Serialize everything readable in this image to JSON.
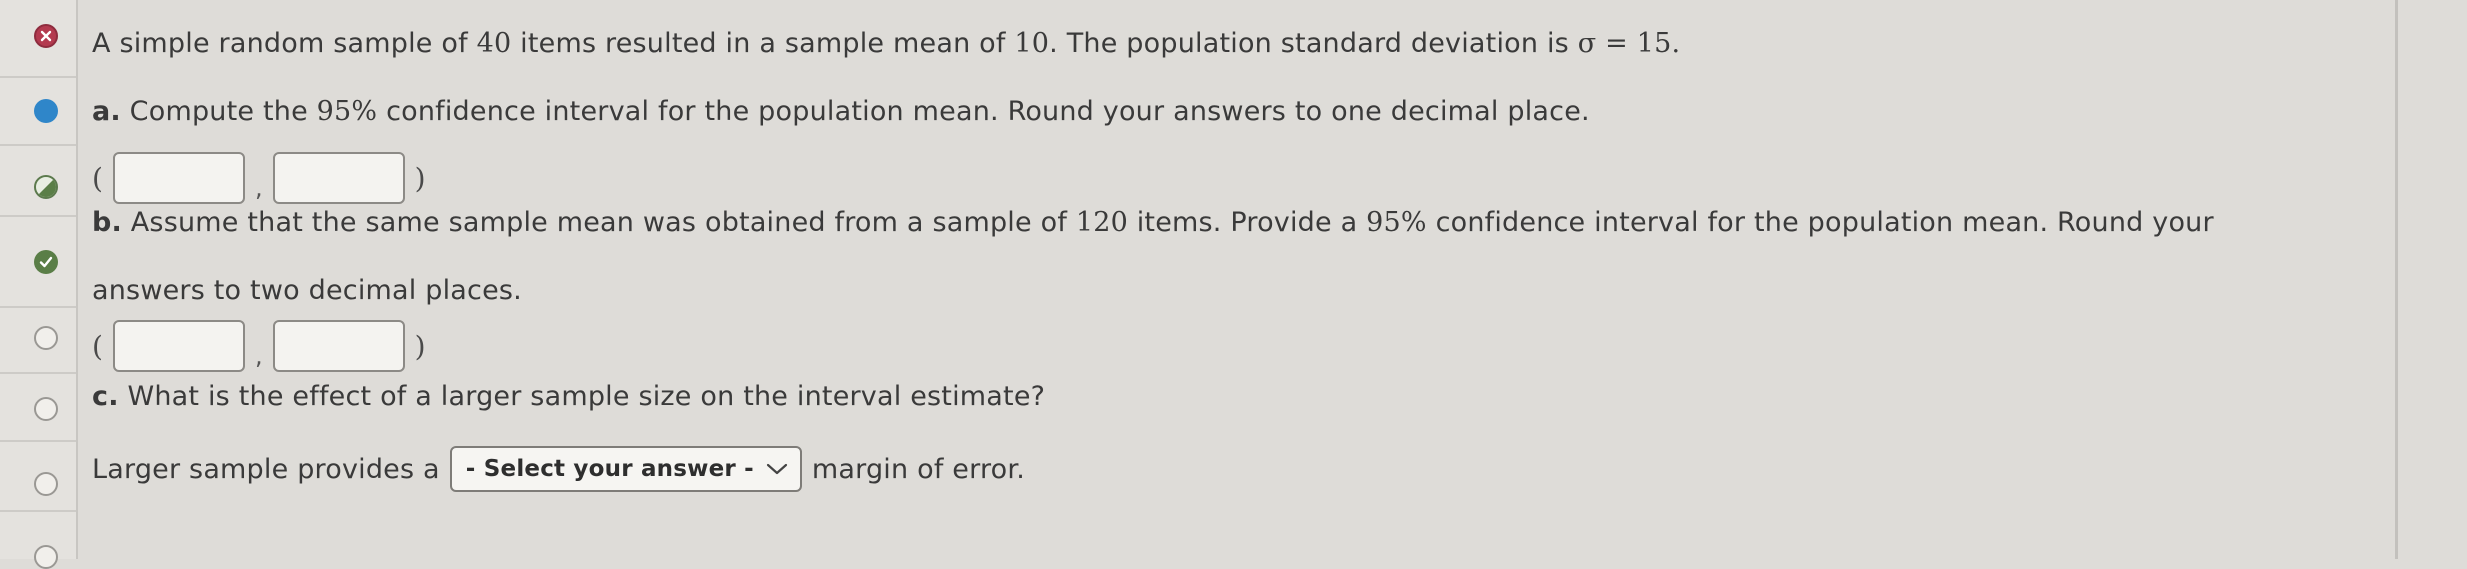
{
  "question": {
    "intro": {
      "text_1": "A simple random sample of ",
      "n": "40",
      "text_2": " items resulted in a sample mean of ",
      "mean": "10",
      "text_3": ". The population standard deviation is ",
      "sigma_expr": "σ = 15",
      "text_4": "."
    },
    "part_a": {
      "letter": "a.",
      "text_1": " Compute the ",
      "pct": "95%",
      "text_2": " confidence interval for the population mean. Round your answers to one decimal place.",
      "open_paren": "(",
      "comma": ",",
      "close_paren": ")"
    },
    "part_b": {
      "letter": "b.",
      "text_1": " Assume that the same sample mean was obtained from a sample of ",
      "n": "120",
      "text_2": " items. Provide a ",
      "pct": "95%",
      "text_3": " confidence interval for the population mean. Round your",
      "line2": "answers to two decimal places.",
      "open_paren": "(",
      "comma": ",",
      "close_paren": ")"
    },
    "part_c": {
      "letter": "c.",
      "text": " What is the effect of a larger sample size on the interval estimate?",
      "answer_prefix": "Larger sample provides a",
      "select_label": "- Select your answer -",
      "answer_suffix": "margin of error."
    }
  }
}
